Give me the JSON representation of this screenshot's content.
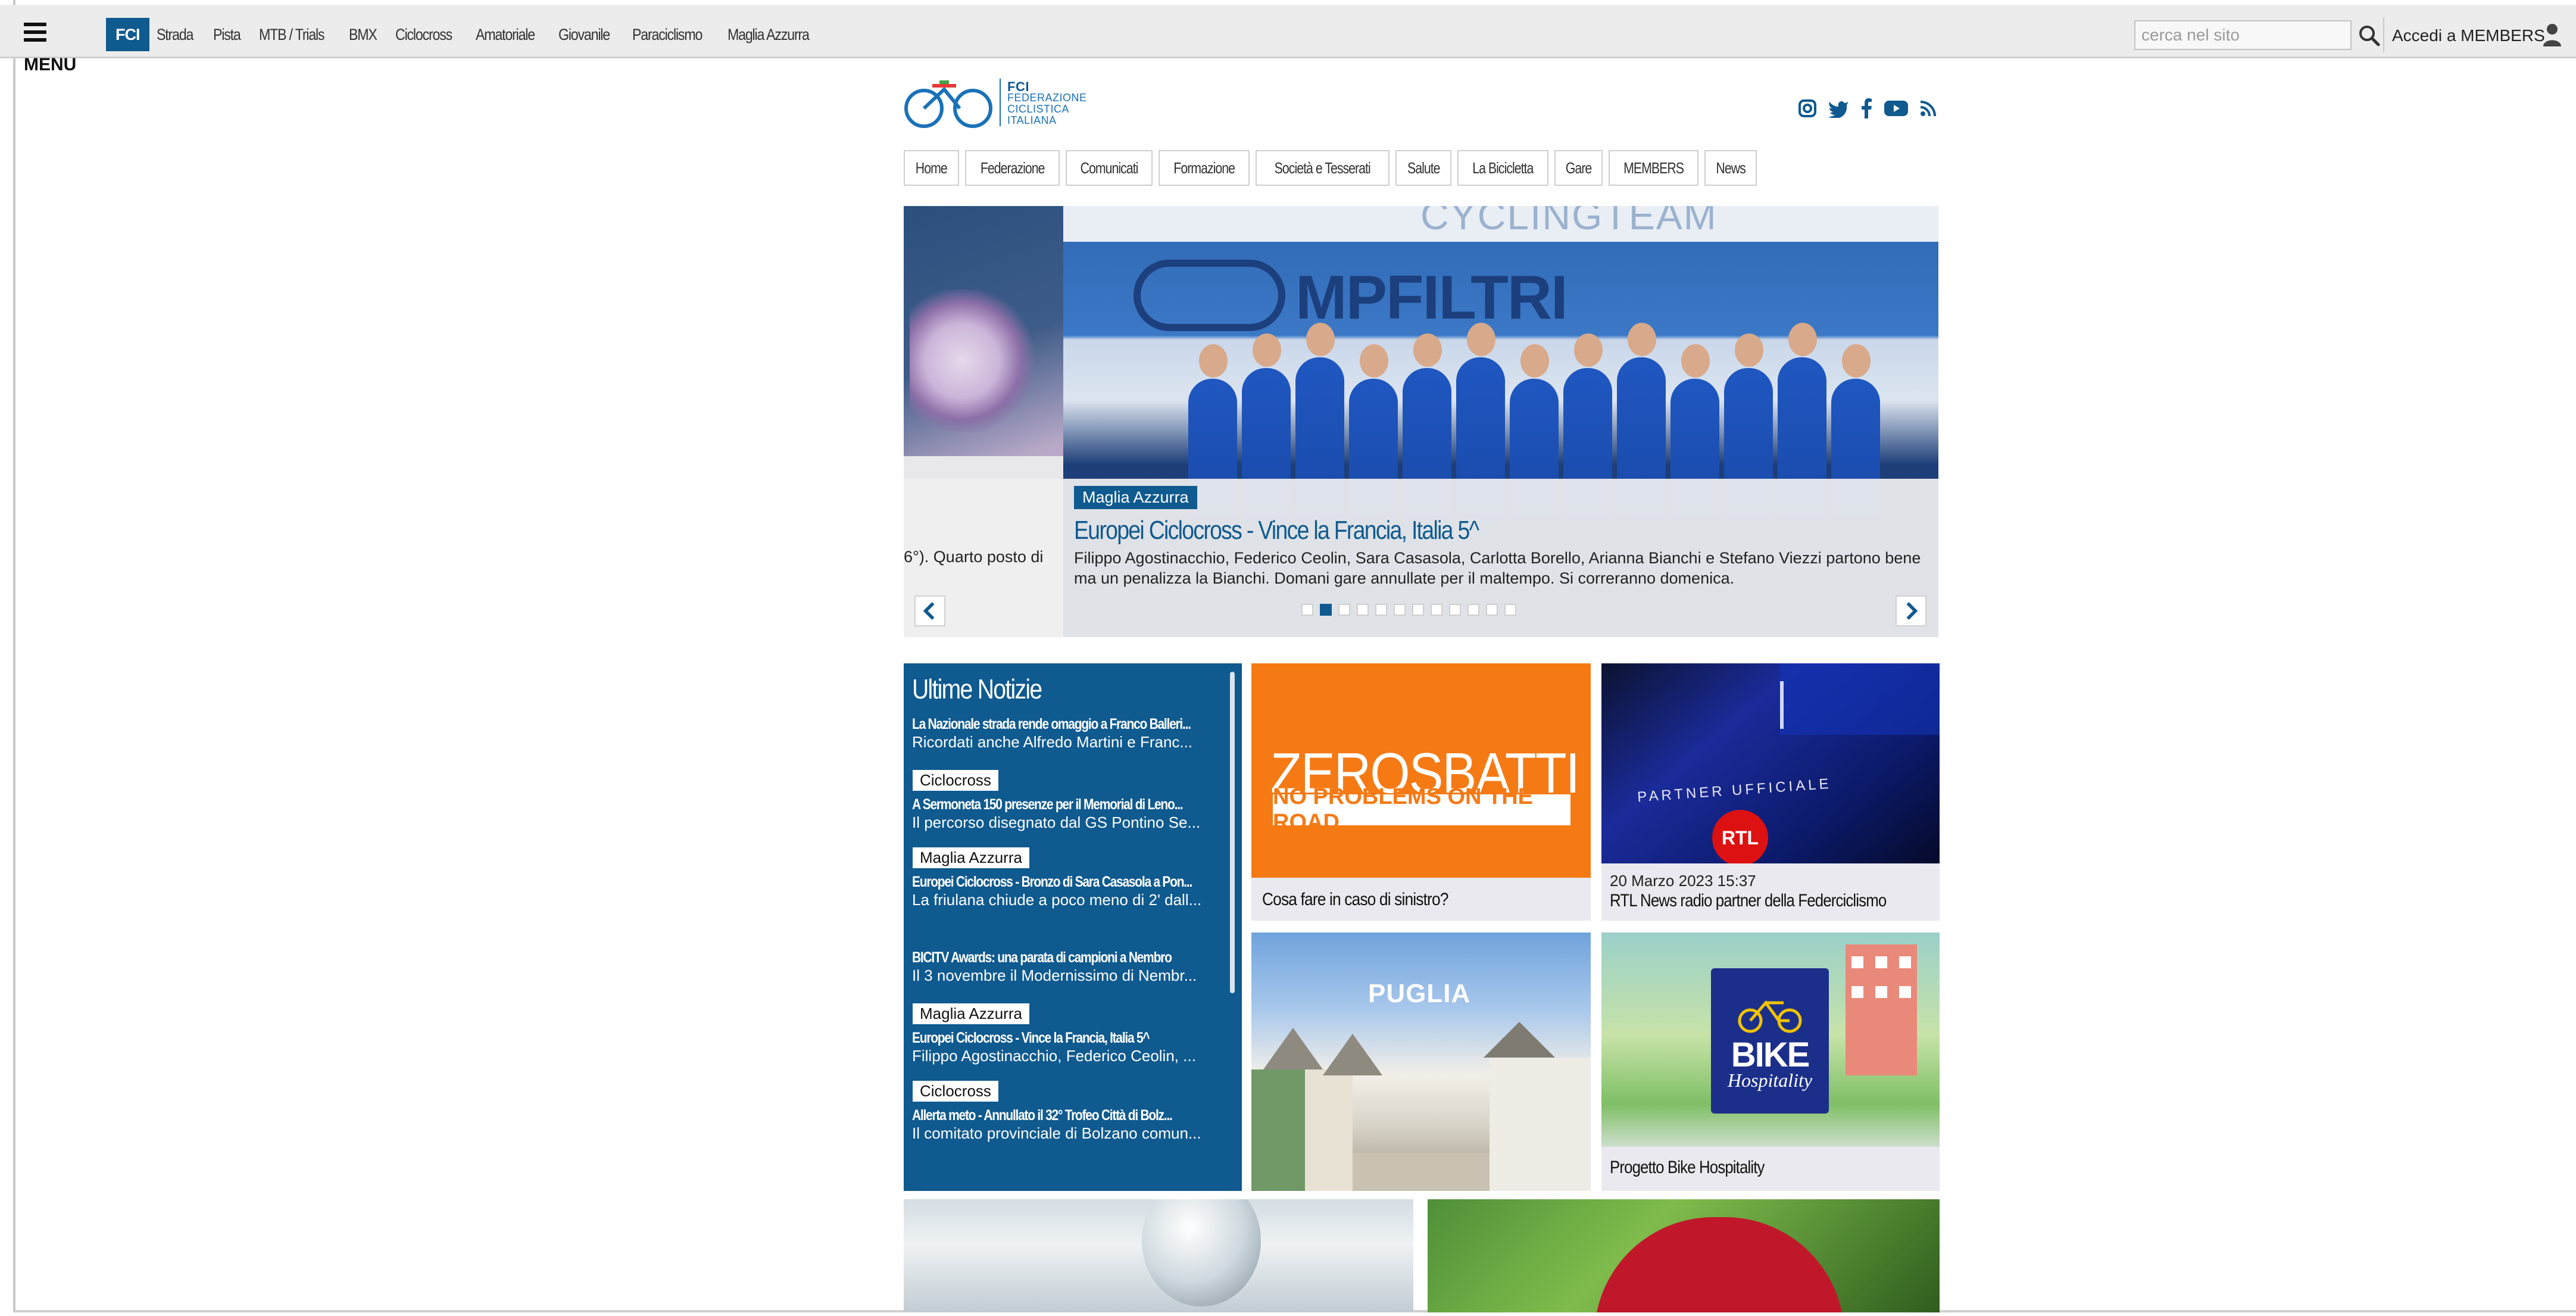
{
  "topbar": {
    "menu_label": "MENU",
    "badge": "FCI",
    "nav": [
      "Strada",
      "Pista",
      "MTB / Trials",
      "BMX",
      "Ciclocross",
      "Amatoriale",
      "Giovanile",
      "Paraciclismo",
      "Maglia Azzurra"
    ],
    "search_placeholder": "cerca nel sito",
    "members_link": "Accedi a MEMBERS"
  },
  "logo": {
    "abbr": "FCI",
    "line1": "FEDERAZIONE",
    "line2": "CICLISTICA",
    "line3": "ITALIANA"
  },
  "social": [
    "instagram-icon",
    "twitter-icon",
    "facebook-icon",
    "youtube-icon",
    "rss-icon"
  ],
  "main_nav": [
    "Home",
    "Federazione",
    "Comunicati",
    "Formazione",
    "Società e Tesserati",
    "Salute",
    "La Bicicletta",
    "Gare",
    "MEMBERS",
    "News"
  ],
  "hero": {
    "photo_brand": "MPFILTRI",
    "photo_brand_line": "CYCLINGTEAM",
    "tag": "Maglia Azzurra",
    "title": "Europei Ciclocross - Vince la Francia, Italia 5^",
    "text": "Filippo Agostinacchio, Federico Ceolin, Sara Casasola, Carlotta Borello, Arianna Bianchi e Stefano Viezzi partono bene ma un penalizza la Bianchi. Domani gare annullate per il maltempo. Si correranno domenica.",
    "prev_text": "6°). Quarto posto di",
    "dots": 12,
    "active_dot": 1
  },
  "news": {
    "title": "Ultime Notizie",
    "items": [
      {
        "tag": "",
        "head": "La Nazionale strada rende omaggio a Franco Balleri...",
        "sub": "Ricordati anche Alfredo Martini e Franc..."
      },
      {
        "tag": "Ciclocross",
        "head": "A Sermoneta 150 presenze per il Memorial di Leno...",
        "sub": "Il percorso disegnato dal GS Pontino Se..."
      },
      {
        "tag": "Maglia Azzurra",
        "head": "Europei Ciclocross - Bronzo di Sara Casasola a Pon...",
        "sub": "La friulana chiude a poco meno di 2' dall..."
      },
      {
        "tag": "",
        "head": "BICITV Awards: una parata di campioni a Nembro",
        "sub": "Il 3 novembre il Modernissimo di Nembr..."
      },
      {
        "tag": "Maglia Azzurra",
        "head": "Europei Ciclocross - Vince la Francia, Italia 5^",
        "sub": "Filippo Agostinacchio, Federico Ceolin, ..."
      },
      {
        "tag": "Ciclocross",
        "head": "Allerta meto - Annullato il 32° Trofeo Città di Bolz...",
        "sub": "Il comitato provinciale di Bolzano comun..."
      }
    ]
  },
  "tiles": {
    "zerosbatti": {
      "brand": "ZEROSBATTI",
      "band": "NO PROBLEMS ON THE ROAD",
      "caption": "Cosa fare in caso di sinistro?"
    },
    "rtl": {
      "partner": "PARTNER UFFICIALE",
      "logo": "RTL",
      "date": "20 Marzo 2023 15:37",
      "caption": "RTL News radio partner della Federciclismo"
    },
    "puglia": {
      "label": "PUGLIA"
    },
    "bike": {
      "big": "BIKE",
      "small": "Hospitality",
      "caption": "Progetto Bike Hospitality"
    }
  }
}
